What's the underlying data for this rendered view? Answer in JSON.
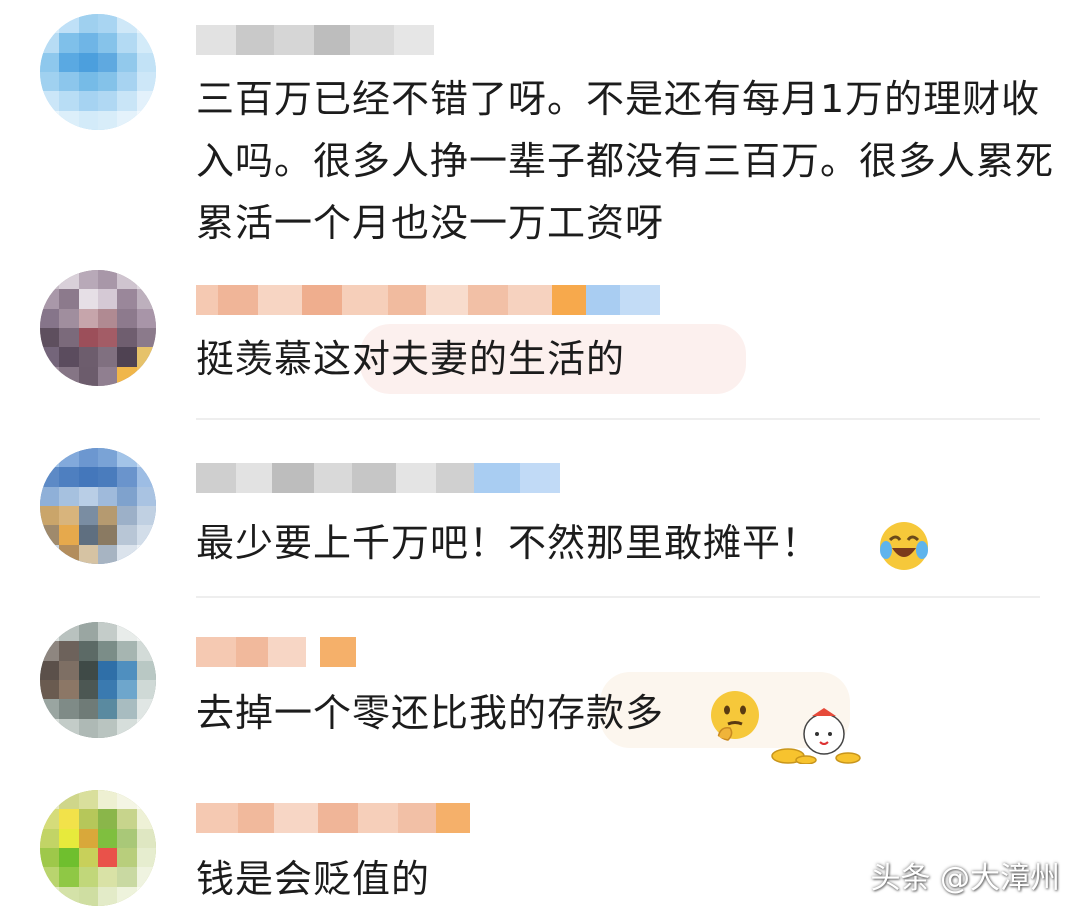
{
  "comments": [
    {
      "text": "三百万已经不错了呀。不是还有每月1万的理财收入吗。很多人挣一辈子都没有三百万。很多人累死累活一个月也没一万工资呀"
    },
    {
      "text": "挺羡慕这对夫妻的生活的"
    },
    {
      "text": "最少要上千万吧！不然那里敢摊平！"
    },
    {
      "text": "去掉一个零还比我的存款多"
    },
    {
      "text": "钱是会贬值的"
    }
  ],
  "watermark": "头条 @大漳州",
  "colors": {
    "text": "#1c1c1c",
    "divider": "#eeeeee",
    "username_blur": "#d8d8d8",
    "emoji_yellow": "#f6c83a"
  },
  "icons": {
    "emoji_1": "laughing-crying-face-icon",
    "emoji_2": "thinking-face-icon",
    "sticker": "fortune-mascot-sticker-icon"
  }
}
